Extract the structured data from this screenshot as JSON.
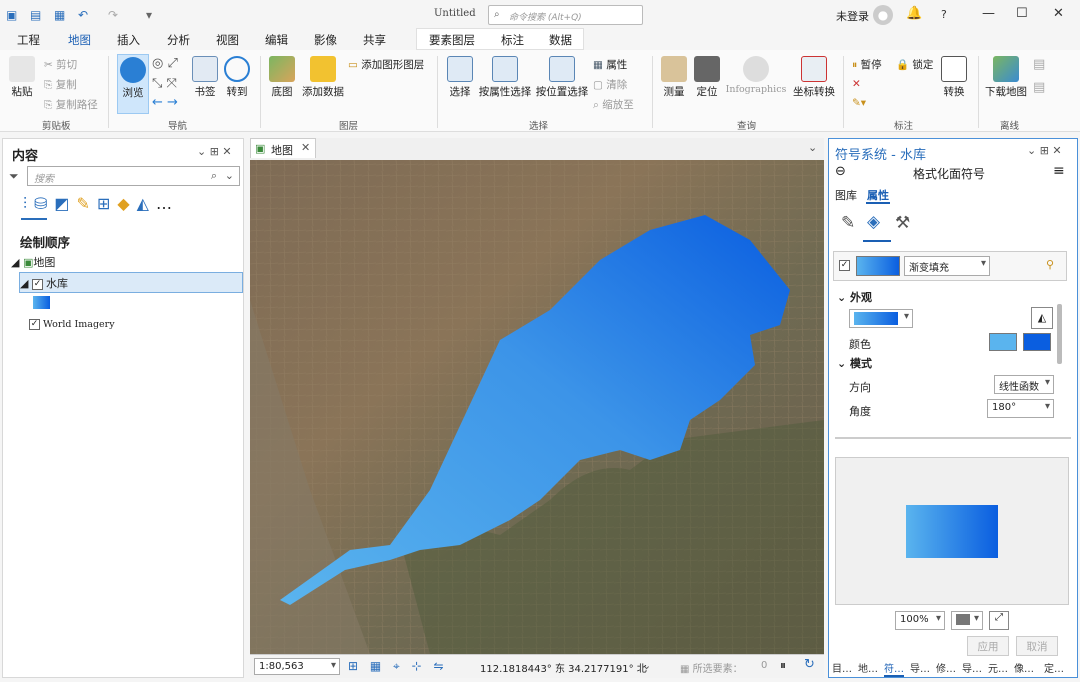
{
  "app": {
    "title": "Untitled",
    "search_placeholder": "命令搜索 (Alt+Q)",
    "user": "未登录",
    "help": "?"
  },
  "menu": {
    "tabs": [
      "工程",
      "地图",
      "插入",
      "分析",
      "视图",
      "编辑",
      "影像",
      "共享"
    ],
    "active": "地图",
    "context_tabs": [
      "要素图层",
      "标注",
      "数据"
    ]
  },
  "ribbon": {
    "clipboard": {
      "paste": "粘贴",
      "cut": "剪切",
      "copy": "复制",
      "copy_path": "复制路径",
      "group": "剪贴板"
    },
    "navigate": {
      "explore": "浏览",
      "bookmarks": "书签",
      "goto": "转到",
      "group": "导航"
    },
    "layer": {
      "basemap": "底图",
      "add_data": "添加数据",
      "add_graphics": "添加图形图层",
      "group": "图层"
    },
    "selection": {
      "select": "选择",
      "by_attr": "按属性选择",
      "by_loc": "按位置选择",
      "attributes": "属性",
      "clear": "清除",
      "zoom_to": "缩放至",
      "group": "选择"
    },
    "inquiry": {
      "measure": "测量",
      "locate": "定位",
      "infographics": "Infographics",
      "convert_coord": "坐标转换",
      "group": "查询"
    },
    "labeling": {
      "pause": "暂停",
      "lock": "锁定",
      "convert": "转换",
      "group": "标注"
    },
    "offline": {
      "download": "下载地图",
      "group": "离线"
    }
  },
  "contents": {
    "title": "内容",
    "search_placeholder": "搜索",
    "draw_order": "绘制顺序",
    "map": "地图",
    "layer1": "水库",
    "layer2": "World Imagery"
  },
  "map_tab": {
    "label": "地图",
    "scale": "1:80,563",
    "coords": "112.1818443° 东 34.2177191° 北",
    "selected": "所选要素：",
    "selected_count": "0"
  },
  "symbology": {
    "title": "符号系统 - 水库",
    "subtitle": "格式化面符号",
    "tab_gallery": "图库",
    "tab_props": "属性",
    "fill_type": "渐变填充",
    "appearance": "外观",
    "color": "颜色",
    "pattern": "模式",
    "direction": "方向",
    "direction_val": "线性函数",
    "angle": "角度",
    "angle_val": "180°",
    "zoom": "100%",
    "apply": "应用",
    "cancel": "取消"
  },
  "bottom_tabs": [
    "目…",
    "地…",
    "符…",
    "导…",
    "修…",
    "导…",
    "元…",
    "像…",
    "定…"
  ],
  "colors": {
    "accent": "#1a5fb4",
    "water_light": "#5ab4ee",
    "water_dark": "#0a5ee0"
  }
}
